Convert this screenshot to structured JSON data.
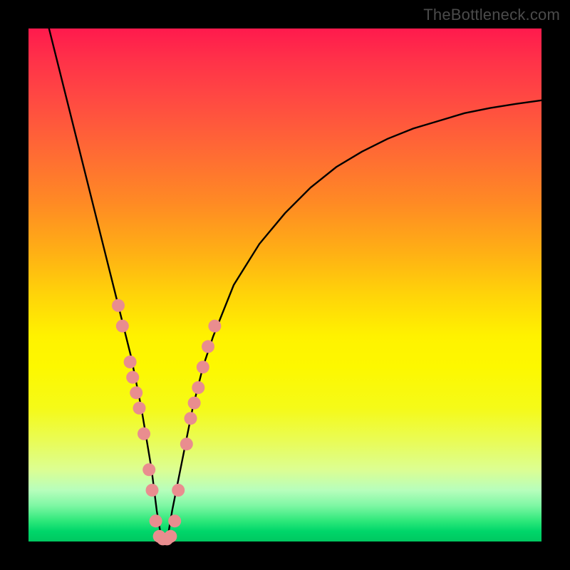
{
  "watermark": "TheBottleneck.com",
  "chart_data": {
    "type": "line",
    "title": "",
    "xlabel": "",
    "ylabel": "",
    "xlim": [
      0,
      100
    ],
    "ylim": [
      0,
      100
    ],
    "background_gradient": {
      "direction": "vertical",
      "stops": [
        {
          "pos": 0,
          "color": "#ff1a4d"
        },
        {
          "pos": 50,
          "color": "#ffd400"
        },
        {
          "pos": 80,
          "color": "#f0fc3a"
        },
        {
          "pos": 100,
          "color": "#00c860"
        }
      ]
    },
    "series": [
      {
        "name": "bottleneck-curve",
        "color": "#000000",
        "x": [
          4,
          6,
          8,
          10,
          12,
          14,
          16,
          18,
          20,
          22,
          24,
          25,
          26,
          27,
          28,
          30,
          32,
          34,
          36,
          40,
          45,
          50,
          55,
          60,
          65,
          70,
          75,
          80,
          85,
          90,
          95,
          100
        ],
        "y": [
          100,
          92,
          84,
          76,
          68,
          60,
          52,
          44,
          36,
          26,
          14,
          6,
          0,
          0,
          6,
          16,
          26,
          34,
          40,
          50,
          58,
          64,
          69,
          73,
          76,
          78.5,
          80.5,
          82,
          83.5,
          84.5,
          85.3,
          86
        ]
      }
    ],
    "markers": {
      "name": "highlight-points",
      "shape": "circle",
      "radius_px": 9,
      "color": "#e98d8f",
      "points_xy": [
        [
          17.5,
          46
        ],
        [
          18.3,
          42
        ],
        [
          19.8,
          35
        ],
        [
          20.3,
          32
        ],
        [
          21.0,
          29
        ],
        [
          21.6,
          26
        ],
        [
          22.5,
          21
        ],
        [
          23.5,
          14
        ],
        [
          24.1,
          10
        ],
        [
          24.8,
          4
        ],
        [
          25.5,
          1
        ],
        [
          26.2,
          0.5
        ],
        [
          27.0,
          0.5
        ],
        [
          27.7,
          1
        ],
        [
          28.5,
          4
        ],
        [
          29.2,
          10
        ],
        [
          30.8,
          19
        ],
        [
          31.6,
          24
        ],
        [
          32.3,
          27
        ],
        [
          33.1,
          30
        ],
        [
          34.0,
          34
        ],
        [
          35.0,
          38
        ],
        [
          36.3,
          42
        ]
      ]
    }
  }
}
